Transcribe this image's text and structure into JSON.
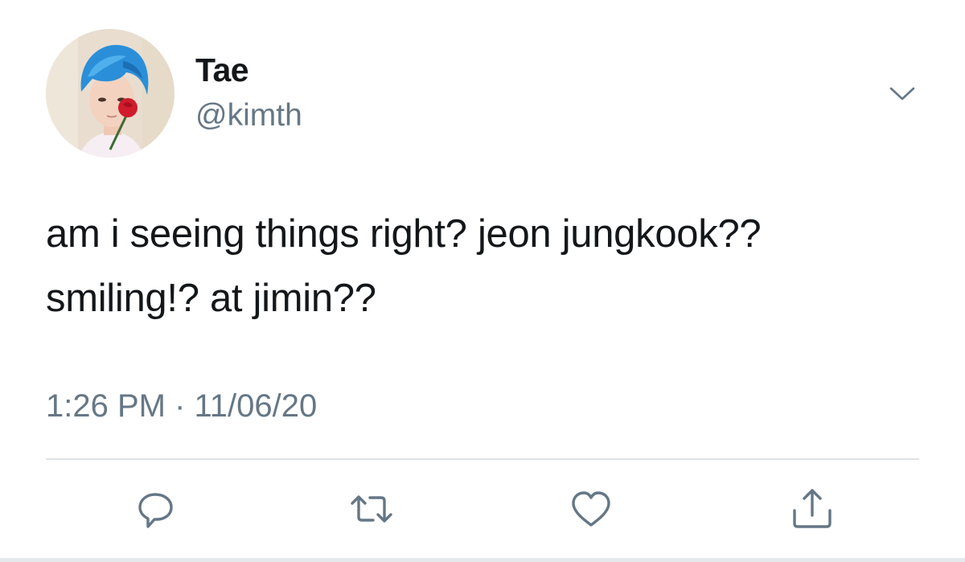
{
  "tweet": {
    "author_name": "Tae",
    "author_handle": "@kimth",
    "text": "am i seeing things right? jeon jungkook?? smiling!? at jimin??",
    "timestamp": "1:26 PM · 11/06/20"
  },
  "icons": {
    "menu": "chevron-down-icon",
    "reply": "reply-icon",
    "retweet": "retweet-icon",
    "like": "heart-icon",
    "share": "share-icon"
  },
  "colors": {
    "text_primary": "#14171a",
    "text_secondary": "#657786",
    "icon": "#657786",
    "divider": "#dfe3e6",
    "avatar_hair": "#2a8fd8",
    "avatar_rose": "#d01b2c"
  }
}
